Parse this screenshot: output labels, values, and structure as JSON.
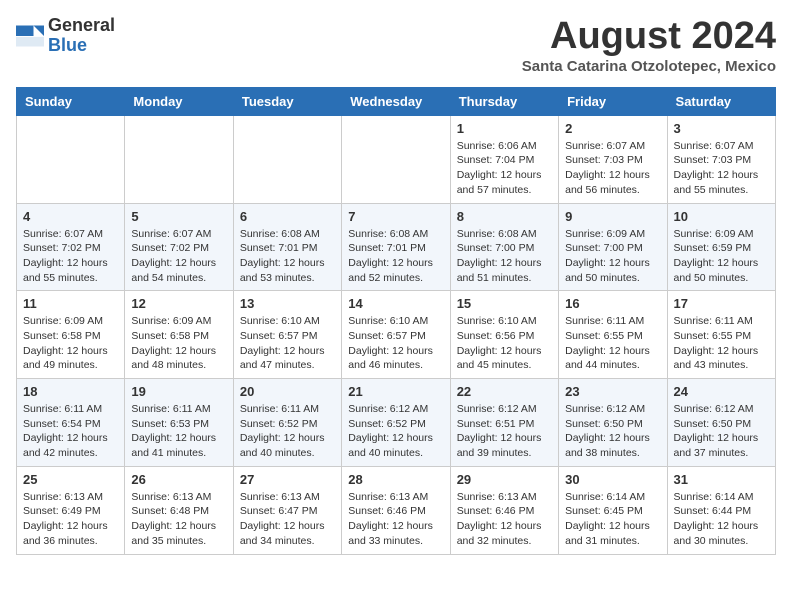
{
  "header": {
    "logo_line1": "General",
    "logo_line2": "Blue",
    "month": "August 2024",
    "location": "Santa Catarina Otzolotepec, Mexico"
  },
  "weekdays": [
    "Sunday",
    "Monday",
    "Tuesday",
    "Wednesday",
    "Thursday",
    "Friday",
    "Saturday"
  ],
  "weeks": [
    [
      {
        "day": "",
        "info": ""
      },
      {
        "day": "",
        "info": ""
      },
      {
        "day": "",
        "info": ""
      },
      {
        "day": "",
        "info": ""
      },
      {
        "day": "1",
        "info": "Sunrise: 6:06 AM\nSunset: 7:04 PM\nDaylight: 12 hours\nand 57 minutes."
      },
      {
        "day": "2",
        "info": "Sunrise: 6:07 AM\nSunset: 7:03 PM\nDaylight: 12 hours\nand 56 minutes."
      },
      {
        "day": "3",
        "info": "Sunrise: 6:07 AM\nSunset: 7:03 PM\nDaylight: 12 hours\nand 55 minutes."
      }
    ],
    [
      {
        "day": "4",
        "info": "Sunrise: 6:07 AM\nSunset: 7:02 PM\nDaylight: 12 hours\nand 55 minutes."
      },
      {
        "day": "5",
        "info": "Sunrise: 6:07 AM\nSunset: 7:02 PM\nDaylight: 12 hours\nand 54 minutes."
      },
      {
        "day": "6",
        "info": "Sunrise: 6:08 AM\nSunset: 7:01 PM\nDaylight: 12 hours\nand 53 minutes."
      },
      {
        "day": "7",
        "info": "Sunrise: 6:08 AM\nSunset: 7:01 PM\nDaylight: 12 hours\nand 52 minutes."
      },
      {
        "day": "8",
        "info": "Sunrise: 6:08 AM\nSunset: 7:00 PM\nDaylight: 12 hours\nand 51 minutes."
      },
      {
        "day": "9",
        "info": "Sunrise: 6:09 AM\nSunset: 7:00 PM\nDaylight: 12 hours\nand 50 minutes."
      },
      {
        "day": "10",
        "info": "Sunrise: 6:09 AM\nSunset: 6:59 PM\nDaylight: 12 hours\nand 50 minutes."
      }
    ],
    [
      {
        "day": "11",
        "info": "Sunrise: 6:09 AM\nSunset: 6:58 PM\nDaylight: 12 hours\nand 49 minutes."
      },
      {
        "day": "12",
        "info": "Sunrise: 6:09 AM\nSunset: 6:58 PM\nDaylight: 12 hours\nand 48 minutes."
      },
      {
        "day": "13",
        "info": "Sunrise: 6:10 AM\nSunset: 6:57 PM\nDaylight: 12 hours\nand 47 minutes."
      },
      {
        "day": "14",
        "info": "Sunrise: 6:10 AM\nSunset: 6:57 PM\nDaylight: 12 hours\nand 46 minutes."
      },
      {
        "day": "15",
        "info": "Sunrise: 6:10 AM\nSunset: 6:56 PM\nDaylight: 12 hours\nand 45 minutes."
      },
      {
        "day": "16",
        "info": "Sunrise: 6:11 AM\nSunset: 6:55 PM\nDaylight: 12 hours\nand 44 minutes."
      },
      {
        "day": "17",
        "info": "Sunrise: 6:11 AM\nSunset: 6:55 PM\nDaylight: 12 hours\nand 43 minutes."
      }
    ],
    [
      {
        "day": "18",
        "info": "Sunrise: 6:11 AM\nSunset: 6:54 PM\nDaylight: 12 hours\nand 42 minutes."
      },
      {
        "day": "19",
        "info": "Sunrise: 6:11 AM\nSunset: 6:53 PM\nDaylight: 12 hours\nand 41 minutes."
      },
      {
        "day": "20",
        "info": "Sunrise: 6:11 AM\nSunset: 6:52 PM\nDaylight: 12 hours\nand 40 minutes."
      },
      {
        "day": "21",
        "info": "Sunrise: 6:12 AM\nSunset: 6:52 PM\nDaylight: 12 hours\nand 40 minutes."
      },
      {
        "day": "22",
        "info": "Sunrise: 6:12 AM\nSunset: 6:51 PM\nDaylight: 12 hours\nand 39 minutes."
      },
      {
        "day": "23",
        "info": "Sunrise: 6:12 AM\nSunset: 6:50 PM\nDaylight: 12 hours\nand 38 minutes."
      },
      {
        "day": "24",
        "info": "Sunrise: 6:12 AM\nSunset: 6:50 PM\nDaylight: 12 hours\nand 37 minutes."
      }
    ],
    [
      {
        "day": "25",
        "info": "Sunrise: 6:13 AM\nSunset: 6:49 PM\nDaylight: 12 hours\nand 36 minutes."
      },
      {
        "day": "26",
        "info": "Sunrise: 6:13 AM\nSunset: 6:48 PM\nDaylight: 12 hours\nand 35 minutes."
      },
      {
        "day": "27",
        "info": "Sunrise: 6:13 AM\nSunset: 6:47 PM\nDaylight: 12 hours\nand 34 minutes."
      },
      {
        "day": "28",
        "info": "Sunrise: 6:13 AM\nSunset: 6:46 PM\nDaylight: 12 hours\nand 33 minutes."
      },
      {
        "day": "29",
        "info": "Sunrise: 6:13 AM\nSunset: 6:46 PM\nDaylight: 12 hours\nand 32 minutes."
      },
      {
        "day": "30",
        "info": "Sunrise: 6:14 AM\nSunset: 6:45 PM\nDaylight: 12 hours\nand 31 minutes."
      },
      {
        "day": "31",
        "info": "Sunrise: 6:14 AM\nSunset: 6:44 PM\nDaylight: 12 hours\nand 30 minutes."
      }
    ]
  ]
}
